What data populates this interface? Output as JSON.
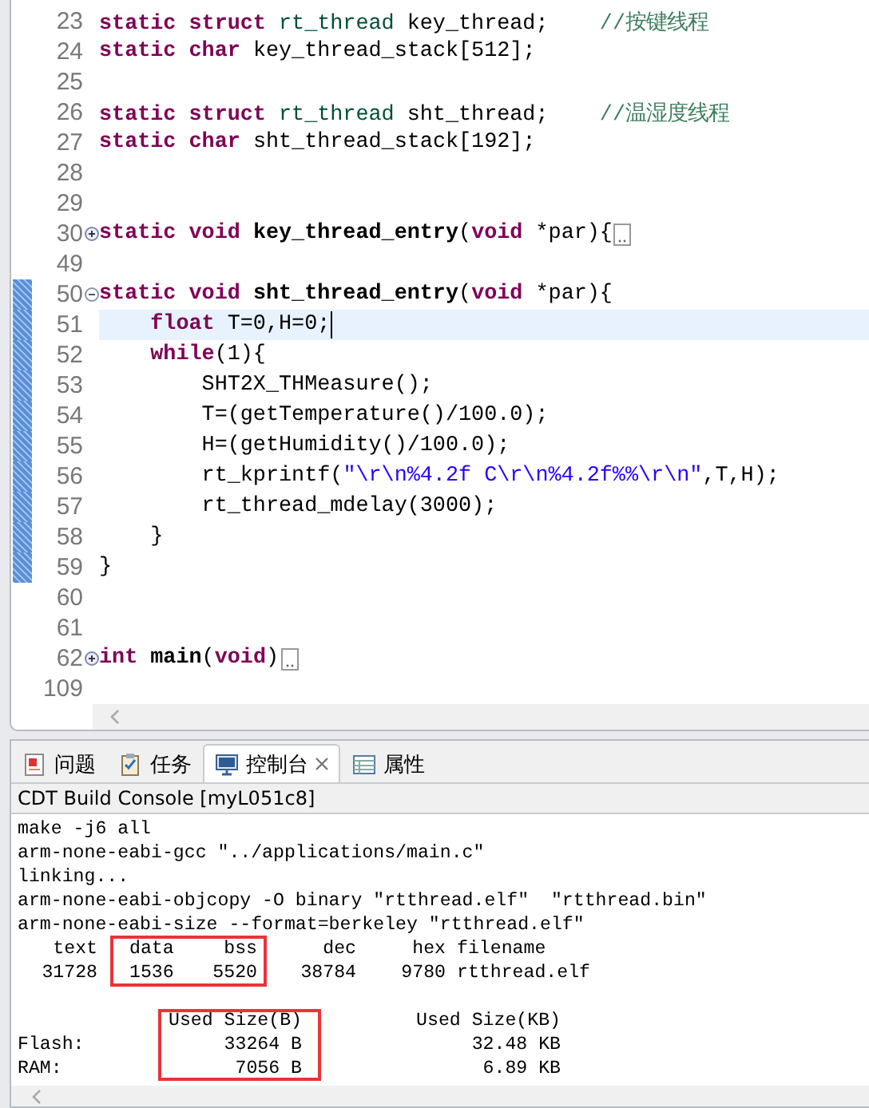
{
  "editor": {
    "lines": [
      {
        "number": "23",
        "current": false,
        "changed": false,
        "folded": false,
        "tokens": [
          {
            "kind": "k",
            "text": "static struct "
          },
          {
            "kind": "t",
            "text": "rt_thread"
          },
          {
            "kind": "p",
            "text": " key_thread;    "
          },
          {
            "kind": "c",
            "text": "//按键线程"
          }
        ]
      },
      {
        "number": "24",
        "current": false,
        "changed": false,
        "folded": false,
        "tokens": [
          {
            "kind": "k",
            "text": "static char"
          },
          {
            "kind": "p",
            "text": " key_thread_stack[512];"
          }
        ]
      },
      {
        "number": "25",
        "current": false,
        "changed": false,
        "folded": false
      },
      {
        "number": "26",
        "current": false,
        "changed": false,
        "folded": false,
        "tokens": [
          {
            "kind": "k",
            "text": "static struct "
          },
          {
            "kind": "t",
            "text": "rt_thread"
          },
          {
            "kind": "p",
            "text": " sht_thread;    "
          },
          {
            "kind": "c",
            "text": "//温湿度线程"
          }
        ]
      },
      {
        "number": "27",
        "current": false,
        "changed": false,
        "folded": false,
        "tokens": [
          {
            "kind": "k",
            "text": "static char"
          },
          {
            "kind": "p",
            "text": " sht_thread_stack[192];"
          }
        ]
      },
      {
        "number": "28",
        "current": false,
        "changed": false,
        "folded": false
      },
      {
        "number": "29",
        "current": false,
        "changed": false,
        "folded": false
      },
      {
        "number": "30",
        "foldable": true,
        "expanded": false,
        "current": false,
        "changed": false,
        "folded": true,
        "tokens": [
          {
            "kind": "k",
            "text": "static void "
          },
          {
            "kind": "f",
            "text": "key_thread_entry"
          },
          {
            "kind": "p",
            "text": "("
          },
          {
            "kind": "k",
            "text": "void"
          },
          {
            "kind": "p",
            "text": " *par){"
          }
        ]
      },
      {
        "number": "49",
        "current": false,
        "changed": false,
        "folded": false
      },
      {
        "number": "50",
        "foldable": true,
        "expanded": true,
        "current": false,
        "changed": true,
        "folded": false,
        "tokens": [
          {
            "kind": "k",
            "text": "static void "
          },
          {
            "kind": "f",
            "text": "sht_thread_entry"
          },
          {
            "kind": "p",
            "text": "("
          },
          {
            "kind": "k",
            "text": "void"
          },
          {
            "kind": "p",
            "text": " *par){"
          }
        ]
      },
      {
        "number": "51",
        "current": true,
        "changed": true,
        "folded": false,
        "tokens": [
          {
            "kind": "k",
            "text": "    float"
          },
          {
            "kind": "p",
            "text": " T=0,H=0;"
          }
        ]
      },
      {
        "number": "52",
        "current": false,
        "changed": true,
        "folded": false,
        "tokens": [
          {
            "kind": "k",
            "text": "    while"
          },
          {
            "kind": "p",
            "text": "(1){"
          }
        ]
      },
      {
        "number": "53",
        "current": false,
        "changed": true,
        "folded": false,
        "tokens": [
          {
            "kind": "p",
            "text": "        SHT2X_THMeasure();"
          }
        ]
      },
      {
        "number": "54",
        "current": false,
        "changed": true,
        "folded": false,
        "tokens": [
          {
            "kind": "p",
            "text": "        T=(getTemperature()/100.0);"
          }
        ]
      },
      {
        "number": "55",
        "current": false,
        "changed": true,
        "folded": false,
        "tokens": [
          {
            "kind": "p",
            "text": "        H=(getHumidity()/100.0);"
          }
        ]
      },
      {
        "number": "56",
        "current": false,
        "changed": true,
        "folded": false,
        "tokens": [
          {
            "kind": "p",
            "text": "        rt_kprintf("
          },
          {
            "kind": "s",
            "text": "\"\\r\\n%4.2f C\\r\\n%4.2f%%\\r\\n\""
          },
          {
            "kind": "p",
            "text": ",T,H);"
          }
        ]
      },
      {
        "number": "57",
        "current": false,
        "changed": true,
        "folded": false,
        "tokens": [
          {
            "kind": "p",
            "text": "        rt_thread_mdelay(3000);"
          }
        ]
      },
      {
        "number": "58",
        "current": false,
        "changed": true,
        "folded": false,
        "tokens": [
          {
            "kind": "p",
            "text": "    }"
          }
        ]
      },
      {
        "number": "59",
        "current": false,
        "changed": true,
        "folded": false,
        "tokens": [
          {
            "kind": "p",
            "text": "}"
          }
        ]
      },
      {
        "number": "60",
        "current": false,
        "changed": false,
        "folded": false
      },
      {
        "number": "61",
        "current": false,
        "changed": false,
        "folded": false
      },
      {
        "number": "62",
        "foldable": true,
        "expanded": false,
        "current": false,
        "changed": false,
        "folded": true,
        "tokens": [
          {
            "kind": "k",
            "text": "int"
          },
          {
            "kind": "f",
            "text": " main"
          },
          {
            "kind": "p",
            "text": "("
          },
          {
            "kind": "k",
            "text": "void"
          },
          {
            "kind": "p",
            "text": ")"
          }
        ]
      },
      {
        "number": "109",
        "current": false,
        "changed": false,
        "folded": false
      }
    ]
  },
  "console_view": {
    "tabs": [
      {
        "label": "问题",
        "kind": "problems",
        "selected": false,
        "closable": false
      },
      {
        "label": "任务",
        "kind": "tasks",
        "selected": false,
        "closable": false
      },
      {
        "label": "控制台",
        "kind": "console",
        "selected": true,
        "closable": true
      },
      {
        "label": "属性",
        "kind": "properties",
        "selected": false,
        "closable": false
      }
    ],
    "title": "CDT Build Console [myL051c8]",
    "lines": [
      "make -j6 all",
      "arm-none-eabi-gcc \"../applications/main.c\"",
      "linking...",
      "arm-none-eabi-objcopy -O binary \"rtthread.elf\"  \"rtthread.bin\"",
      "arm-none-eabi-size --format=berkeley \"rtthread.elf\""
    ],
    "size_table": {
      "columns": [
        {
          "header": "text",
          "value": "31728",
          "boxed": false
        },
        {
          "header": "data",
          "value": "1536",
          "boxed": true
        },
        {
          "header": "bss",
          "value": "5520",
          "boxed": true
        },
        {
          "header": "dec",
          "value": "38784",
          "boxed": false
        },
        {
          "header": "hex",
          "value": "9780",
          "boxed": false
        },
        {
          "header": "filename",
          "value": "rtthread.elf",
          "boxed": false
        }
      ]
    },
    "usage_table": {
      "columns": [
        {
          "header": "Used Size(B)",
          "boxed": true
        },
        {
          "header": "Used Size(KB)",
          "boxed": false
        }
      ],
      "rows": [
        {
          "label": "Flash:",
          "values": [
            "33264 B",
            "32.48 KB"
          ]
        },
        {
          "label": "RAM:",
          "values": [
            "7056 B",
            "6.89 KB"
          ]
        }
      ]
    }
  }
}
